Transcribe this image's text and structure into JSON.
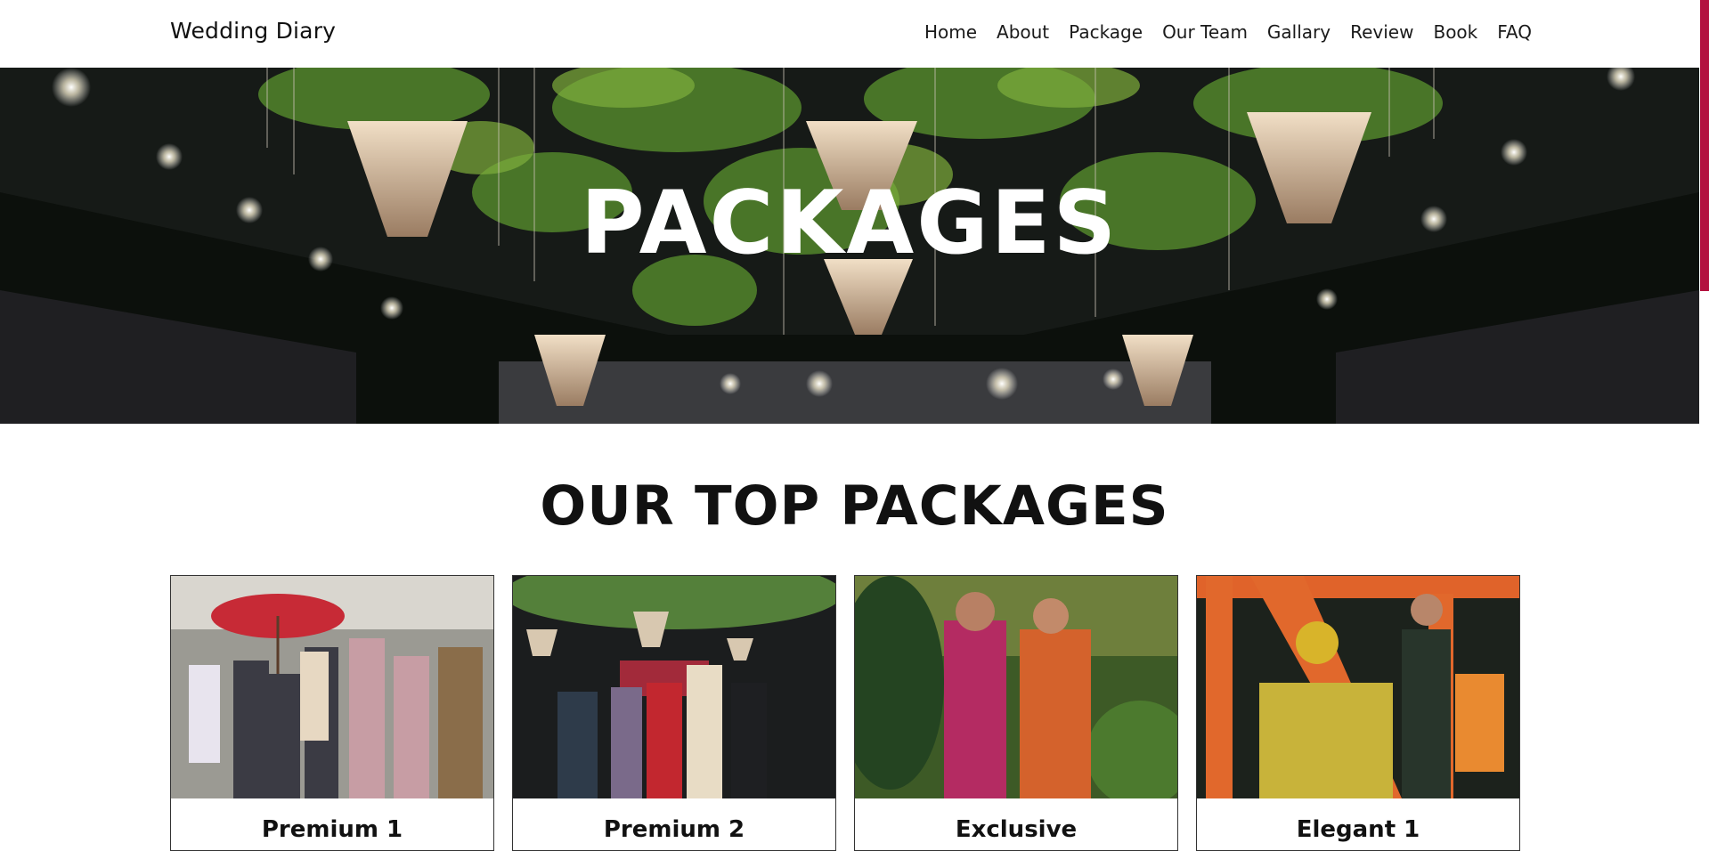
{
  "header": {
    "brand": "Wedding Diary",
    "nav": [
      "Home",
      "About",
      "Package",
      "Our Team",
      "Gallary",
      "Review",
      "Book",
      "FAQ"
    ]
  },
  "hero": {
    "title": "PACKAGES"
  },
  "section": {
    "title": "OUR TOP PACKAGES"
  },
  "cards": [
    {
      "title": "Premium 1"
    },
    {
      "title": "Premium 2"
    },
    {
      "title": "Exclusive"
    },
    {
      "title": "Elegant 1"
    }
  ],
  "colors": {
    "accent": "#b3123f"
  }
}
